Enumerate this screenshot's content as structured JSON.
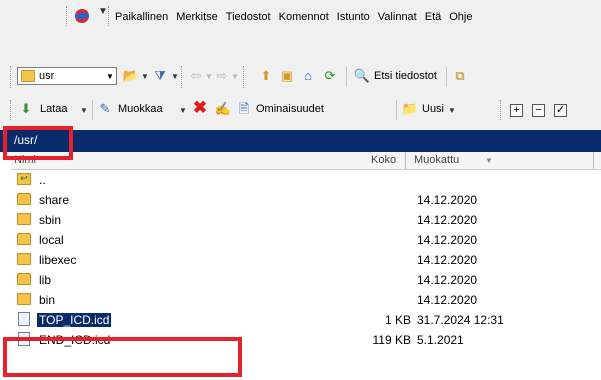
{
  "menu": {
    "items": [
      "Paikallinen",
      "Merkitse",
      "Tiedostot",
      "Komennot",
      "Istunto",
      "Valinnat",
      "Etä",
      "Ohje"
    ]
  },
  "toolbar1": {
    "drive_label": "usr",
    "find_files_label": "Etsi tiedostot"
  },
  "toolbar2": {
    "download_label": "Lataa",
    "edit_label": "Muokkaa",
    "properties_label": "Ominaisuudet",
    "new_label": "Uusi"
  },
  "path": "/usr/",
  "columns": {
    "name": "Nimi",
    "size": "Koko",
    "modified": "Muokattu"
  },
  "rows": [
    {
      "name": "..",
      "size": "",
      "date": ""
    },
    {
      "name": "share",
      "size": "",
      "date": "14.12.2020"
    },
    {
      "name": "sbin",
      "size": "",
      "date": "14.12.2020"
    },
    {
      "name": "local",
      "size": "",
      "date": "14.12.2020"
    },
    {
      "name": "libexec",
      "size": "",
      "date": "14.12.2020"
    },
    {
      "name": "lib",
      "size": "",
      "date": "14.12.2020"
    },
    {
      "name": "bin",
      "size": "",
      "date": "14.12.2020"
    },
    {
      "name": "TOP_ICD.icd",
      "size": "1 KB",
      "date": "31.7.2024 12:31"
    },
    {
      "name": "END_ICD.icd",
      "size": "119 KB",
      "date": "5.1.2021"
    }
  ],
  "colors": {
    "path_bar": "#0a2b6b",
    "highlight": "#e8202a",
    "folder": "#f5c24a"
  }
}
